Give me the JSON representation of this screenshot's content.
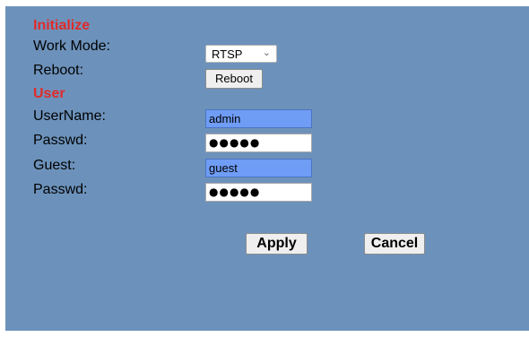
{
  "initialize": {
    "heading": "Initialize",
    "work_mode_label": "Work Mode:",
    "work_mode_value": "RTSP",
    "reboot_label": "Reboot:",
    "reboot_button": "Reboot"
  },
  "user": {
    "heading": "User",
    "username_label": "UserName:",
    "username_value": "admin",
    "passwd_label": "Passwd:",
    "passwd_value": "●●●●●",
    "guest_label": "Guest:",
    "guest_value": "guest",
    "guest_passwd_label": "Passwd:",
    "guest_passwd_value": "●●●●●"
  },
  "actions": {
    "apply": "Apply",
    "cancel": "Cancel"
  },
  "colors": {
    "panel_bg": "#6c92bb",
    "heading": "#e02b2b",
    "autofill_bg": "#6f9cf5"
  }
}
